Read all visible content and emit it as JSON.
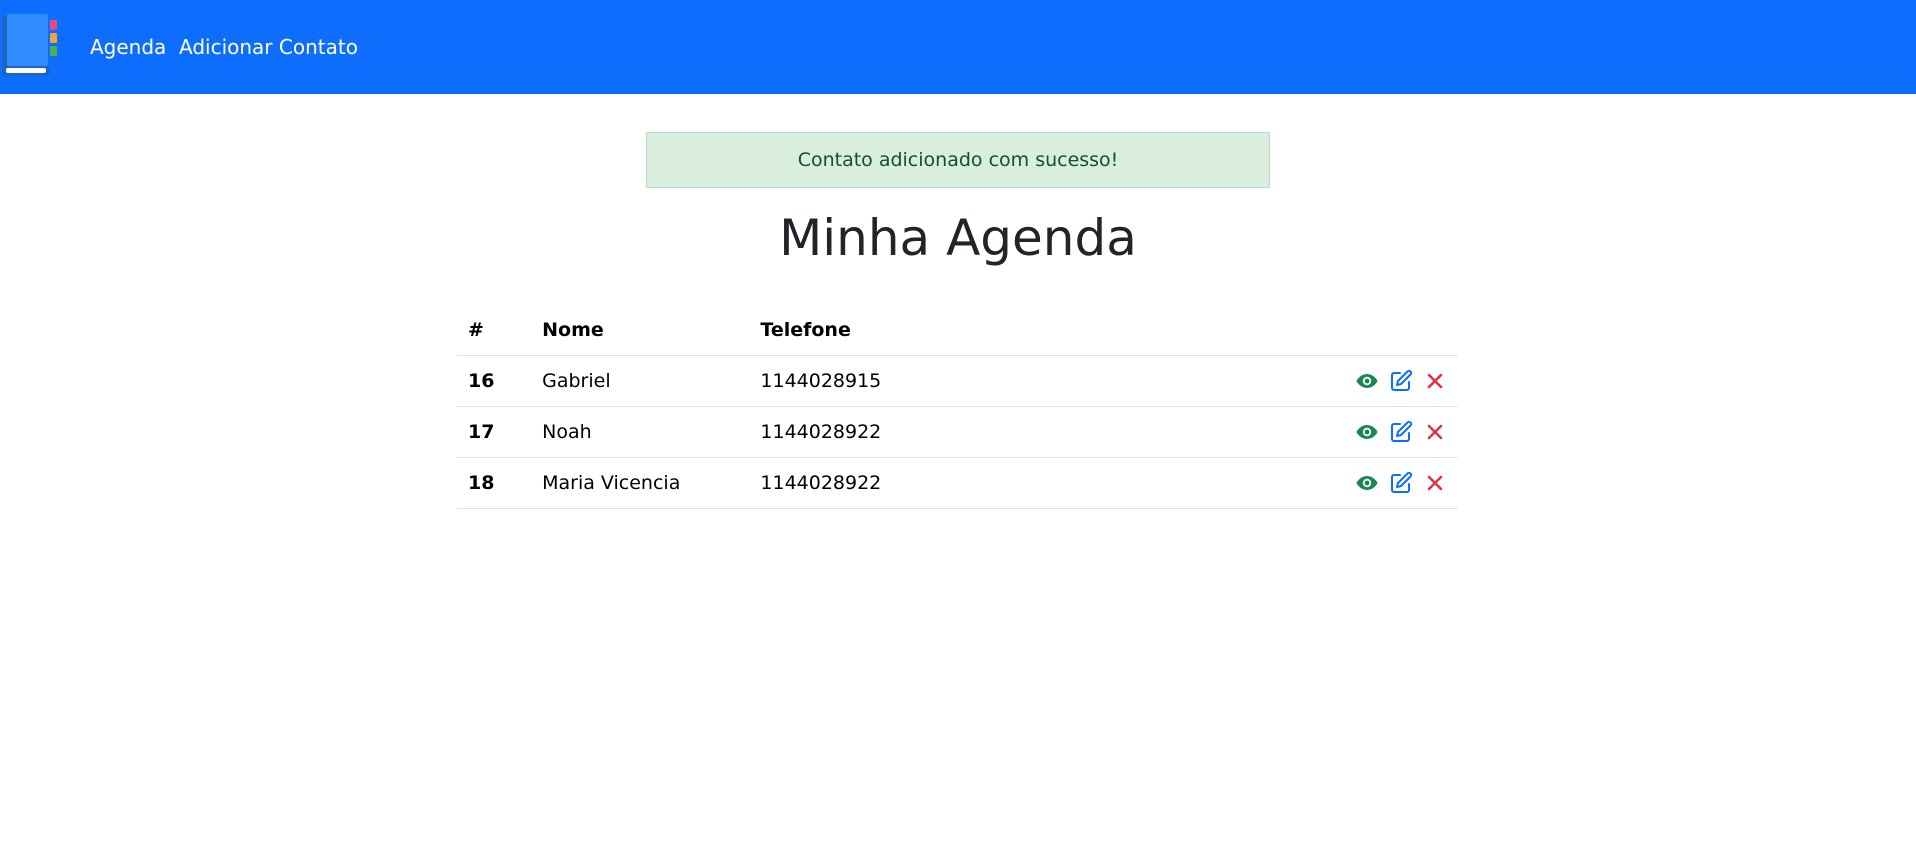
{
  "navbar": {
    "logo_icon": "address-book-icon",
    "links": [
      "Agenda",
      "Adicionar Contato"
    ],
    "bg_color": "#0d6efd"
  },
  "alert": {
    "message": "Contato adicionado com sucesso!",
    "type": "success"
  },
  "page": {
    "title": "Minha Agenda"
  },
  "table": {
    "headers": [
      "#",
      "Nome",
      "Telefone",
      ""
    ],
    "rows": [
      {
        "id": "16",
        "nome": "Gabriel",
        "telefone": "1144028915"
      },
      {
        "id": "17",
        "nome": "Noah",
        "telefone": "1144028922"
      },
      {
        "id": "18",
        "nome": "Maria Vicencia",
        "telefone": "1144028922"
      }
    ],
    "row_actions": [
      {
        "icon": "eye-icon",
        "color": "#198754"
      },
      {
        "icon": "edit-icon",
        "color": "#0d6efd"
      },
      {
        "icon": "close-icon",
        "color": "#dc3545"
      }
    ]
  }
}
